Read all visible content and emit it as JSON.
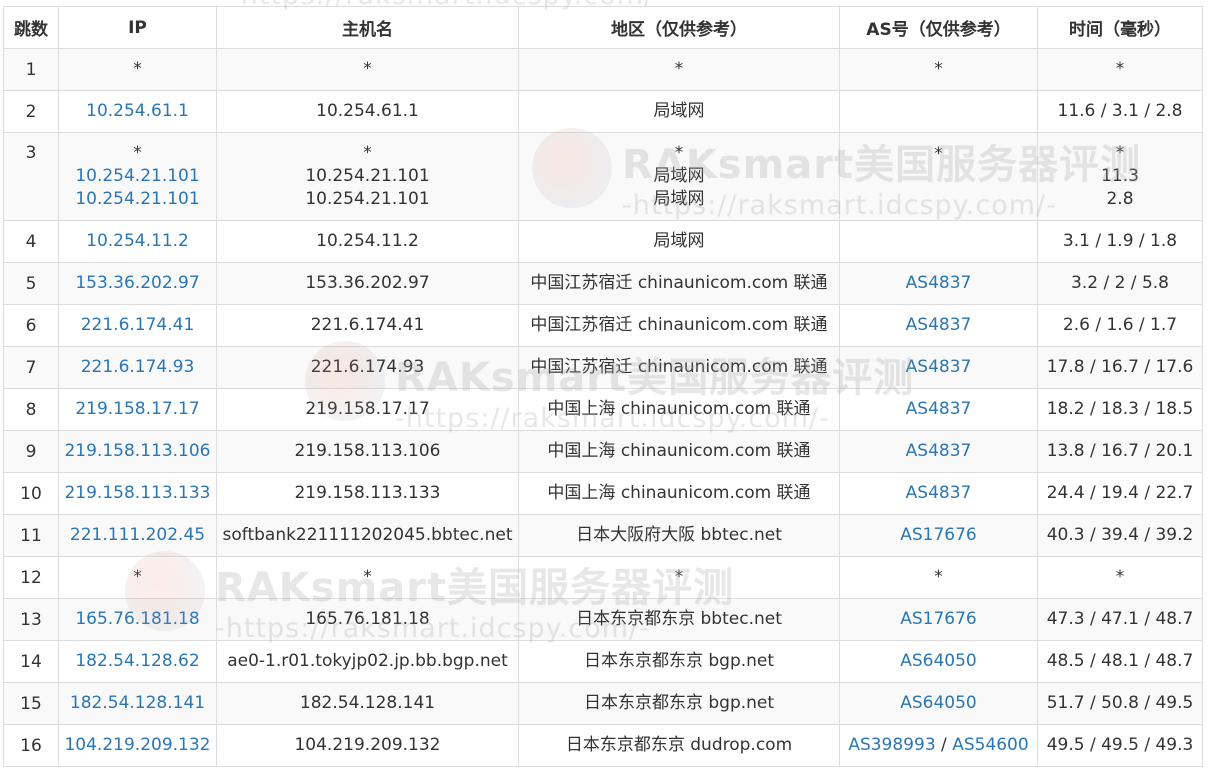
{
  "table": {
    "headers": [
      "跳数",
      "IP",
      "主机名",
      "地区（仅供参考）",
      "AS号（仅供参考）",
      "时间（毫秒）"
    ],
    "rows": [
      {
        "hop": "1",
        "ips": [
          "*"
        ],
        "hosts": [
          "*"
        ],
        "regions": [
          "*"
        ],
        "as": [
          "*"
        ],
        "times": [
          "*"
        ]
      },
      {
        "hop": "2",
        "ips": [
          "10.254.61.1"
        ],
        "hosts": [
          "10.254.61.1"
        ],
        "regions": [
          "局域网"
        ],
        "as": [],
        "times": [
          "11.6 / 3.1 / 2.8"
        ]
      },
      {
        "hop": "3",
        "ips": [
          "*",
          "10.254.21.101",
          "10.254.21.101"
        ],
        "hosts": [
          "*",
          "10.254.21.101",
          "10.254.21.101"
        ],
        "regions": [
          "*",
          "局域网",
          "局域网"
        ],
        "as": [
          "*"
        ],
        "times": [
          "*",
          "11.3",
          "2.8"
        ]
      },
      {
        "hop": "4",
        "ips": [
          "10.254.11.2"
        ],
        "hosts": [
          "10.254.11.2"
        ],
        "regions": [
          "局域网"
        ],
        "as": [],
        "times": [
          "3.1 / 1.9 / 1.8"
        ]
      },
      {
        "hop": "5",
        "ips": [
          "153.36.202.97"
        ],
        "hosts": [
          "153.36.202.97"
        ],
        "regions": [
          "中国江苏宿迁 chinaunicom.com 联通"
        ],
        "as": [
          "AS4837"
        ],
        "times": [
          "3.2 / 2 / 5.8"
        ]
      },
      {
        "hop": "6",
        "ips": [
          "221.6.174.41"
        ],
        "hosts": [
          "221.6.174.41"
        ],
        "regions": [
          "中国江苏宿迁 chinaunicom.com 联通"
        ],
        "as": [
          "AS4837"
        ],
        "times": [
          "2.6 / 1.6 / 1.7"
        ]
      },
      {
        "hop": "7",
        "ips": [
          "221.6.174.93"
        ],
        "hosts": [
          "221.6.174.93"
        ],
        "regions": [
          "中国江苏宿迁 chinaunicom.com 联通"
        ],
        "as": [
          "AS4837"
        ],
        "times": [
          "17.8 / 16.7 / 17.6"
        ]
      },
      {
        "hop": "8",
        "ips": [
          "219.158.17.17"
        ],
        "hosts": [
          "219.158.17.17"
        ],
        "regions": [
          "中国上海 chinaunicom.com 联通"
        ],
        "as": [
          "AS4837"
        ],
        "times": [
          "18.2 / 18.3 / 18.5"
        ]
      },
      {
        "hop": "9",
        "ips": [
          "219.158.113.106"
        ],
        "hosts": [
          "219.158.113.106"
        ],
        "regions": [
          "中国上海 chinaunicom.com 联通"
        ],
        "as": [
          "AS4837"
        ],
        "times": [
          "13.8 / 16.7 / 20.1"
        ]
      },
      {
        "hop": "10",
        "ips": [
          "219.158.113.133"
        ],
        "hosts": [
          "219.158.113.133"
        ],
        "regions": [
          "中国上海 chinaunicom.com 联通"
        ],
        "as": [
          "AS4837"
        ],
        "times": [
          "24.4 / 19.4 / 22.7"
        ]
      },
      {
        "hop": "11",
        "ips": [
          "221.111.202.45"
        ],
        "hosts": [
          "softbank221111202045.bbtec.net"
        ],
        "regions": [
          "日本大阪府大阪 bbtec.net"
        ],
        "as": [
          "AS17676"
        ],
        "times": [
          "40.3 / 39.4 / 39.2"
        ]
      },
      {
        "hop": "12",
        "ips": [
          "*"
        ],
        "hosts": [
          "*"
        ],
        "regions": [
          "*"
        ],
        "as": [
          "*"
        ],
        "times": [
          "*"
        ]
      },
      {
        "hop": "13",
        "ips": [
          "165.76.181.18"
        ],
        "hosts": [
          "165.76.181.18"
        ],
        "regions": [
          "日本东京都东京 bbtec.net"
        ],
        "as": [
          "AS17676"
        ],
        "times": [
          "47.3 / 47.1 / 48.7"
        ]
      },
      {
        "hop": "14",
        "ips": [
          "182.54.128.62"
        ],
        "hosts": [
          "ae0-1.r01.tokyjp02.jp.bb.bgp.net"
        ],
        "regions": [
          "日本东京都东京 bgp.net"
        ],
        "as": [
          "AS64050"
        ],
        "times": [
          "48.5 / 48.1 / 48.7"
        ]
      },
      {
        "hop": "15",
        "ips": [
          "182.54.128.141"
        ],
        "hosts": [
          "182.54.128.141"
        ],
        "regions": [
          "日本东京都东京 bgp.net"
        ],
        "as": [
          "AS64050"
        ],
        "times": [
          "51.7 / 50.8 / 49.5"
        ]
      },
      {
        "hop": "16",
        "ips": [
          "104.219.209.132"
        ],
        "hosts": [
          "104.219.209.132"
        ],
        "regions": [
          "日本东京都东京 dudrop.com"
        ],
        "as": [
          "AS398993",
          "AS54600"
        ],
        "times": [
          "49.5 / 49.5 / 49.3"
        ]
      }
    ]
  },
  "as_separator": " / ",
  "watermark": {
    "title": "RAKsmart美国服务器评测",
    "url": "-https://raksmart.idcspy.com/-"
  },
  "colors": {
    "link": "#2a76b5",
    "text": "#333333",
    "border": "#dddddd",
    "stripe": "#f9f9f9"
  }
}
